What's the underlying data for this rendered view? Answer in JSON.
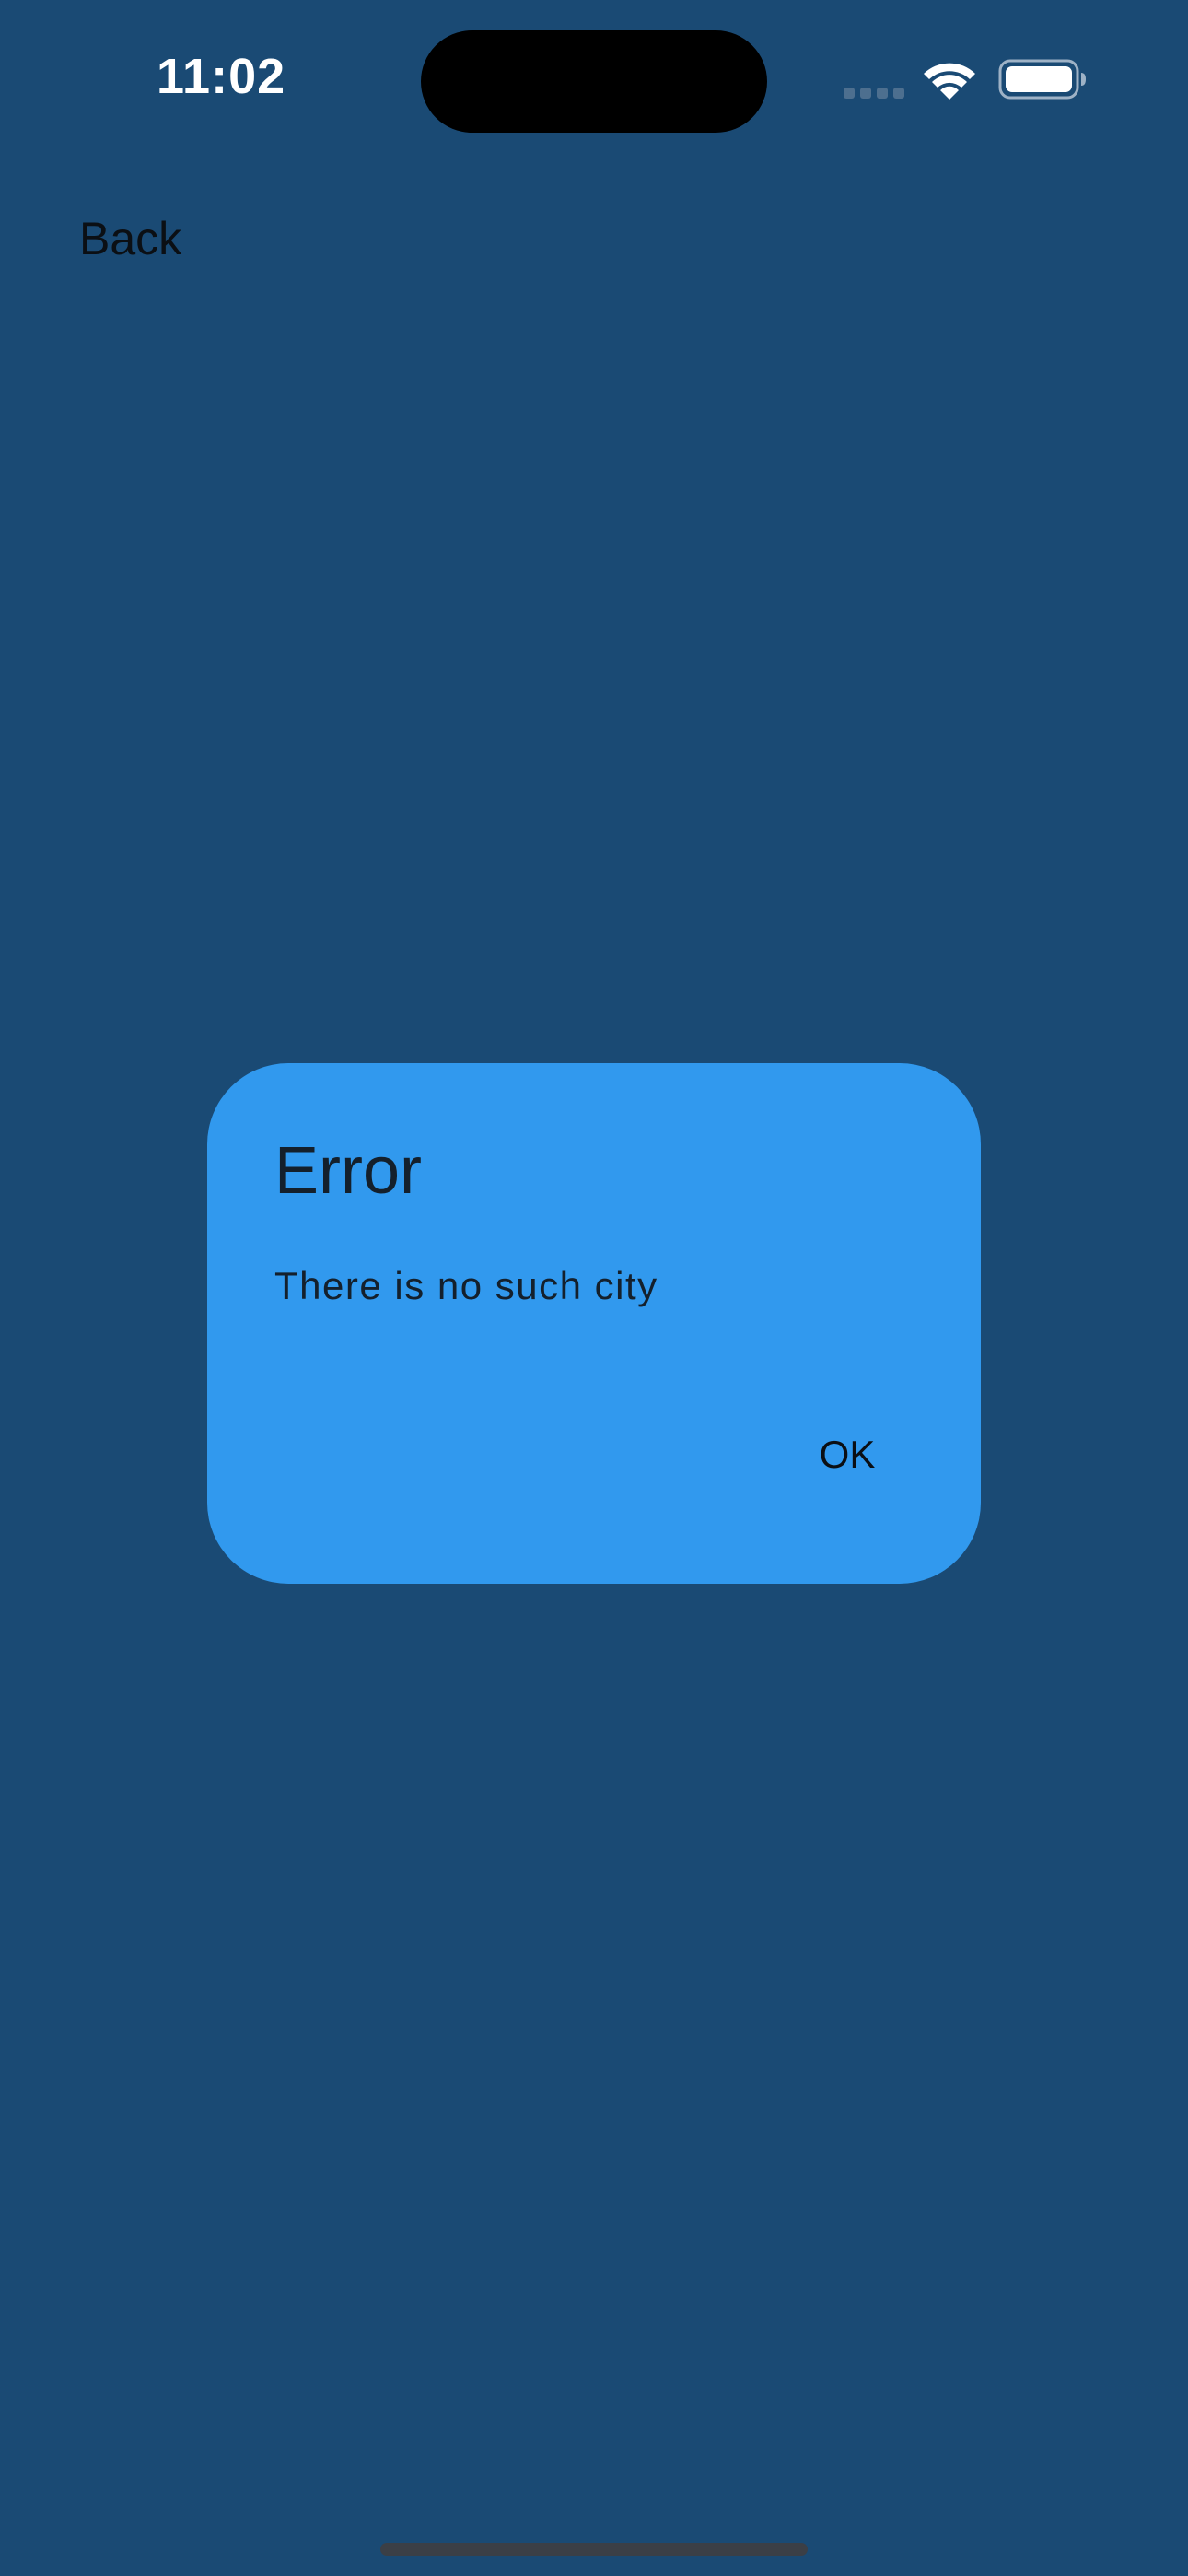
{
  "status_bar": {
    "time": "11:02"
  },
  "nav": {
    "back_label": "Back"
  },
  "dialog": {
    "title": "Error",
    "message": "There is no such city",
    "ok_label": "OK"
  },
  "icons": {
    "signal": "cellular-signal-icon",
    "wifi": "wifi-icon",
    "battery": "battery-icon"
  },
  "colors": {
    "background": "#1a4a74",
    "dialog": "#3199ee",
    "text_dark": "#14202c",
    "status_text": "#ffffff"
  }
}
